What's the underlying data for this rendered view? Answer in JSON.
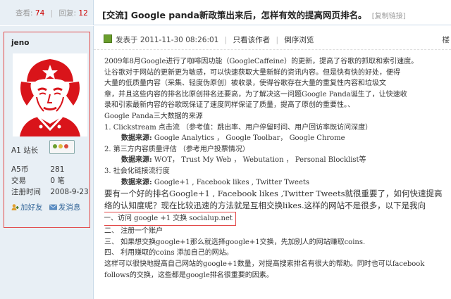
{
  "stats": {
    "views_label": "查看:",
    "views": "74",
    "replies_label": "回复:",
    "replies": "12"
  },
  "thread": {
    "title": "[交流] Google panda新政策出来后，怎样有效的提高网页排名。",
    "copy_link": "[复制链接]"
  },
  "user": {
    "name": "jeno",
    "level": "A1 站长",
    "info": [
      {
        "k": "A5币",
        "v": "281"
      },
      {
        "k": "交易",
        "v": "0 笔"
      },
      {
        "k": "注册时间",
        "v": "2008-9-23"
      }
    ],
    "add_friend": "加好友",
    "send_msg": "发消息"
  },
  "post": {
    "meta": "发表于 2011-11-30 08:26:01",
    "author_only": "只看该作者",
    "reverse": "倒序浏览",
    "floor": "楼"
  },
  "body": {
    "l1": "2009年8月Google进行了咖啡因功能（GoogleCaffeine）的更新，提高了谷歌的抓取和索引速度。",
    "l2": "让谷歌对于网站的更新更为敏感，可以快速获取大量新鲜的资讯内容。但是快有快的好处，便得",
    "l3": "大量的低质量内容（采集、轻度伪原创）被收录，使得谷歌存在大量的重复性内容和垃圾文",
    "l4": "章，并且这些内容的排名比原创排名还要高，为了解决这一问题Google Panda诞生了，让快速收",
    "l5": "录和引索最新内容的谷歌既保证了速度同样保证了质量，提高了原创的重要性。、",
    "l6": "Google Panda三大数据的来源",
    "l7": "1. Clickstream 点击流 （参考值：跳出率、用户停留时间、用户回访率既访问深度）",
    "l8_label": "数据来源:",
    "l8": " Google Analytics ， Google Toolbar， Google Chrome",
    "l9": "2. 第三方内容质量评估 （参考用户投票情况）",
    "l10_label": "数据来源:",
    "l10": " WOT， Trust My Web ， Webutation ， Personal Blocklist等",
    "l11": "3. 社会化链接流行度",
    "l12_label": "数据来源:",
    "l12": " Google+1 , Facebook likes , Twitter Tweets",
    "l13": "  要有一个好的排名Google+1 , Facebook likes ,Twitter Tweets就很重要了，如何快速提高",
    "l14": "络的认知度呢？现在比较迅速的方法就是互相交换likes.这样的网站不是很多，以下是我向",
    "l15": "一、访问 google +1 交换 socialup.net",
    "l16": "二、  注册一个账户",
    "l17": "三、  如果想交换google+1那么就选择google+1交换，先加别人的网站赚取coins.",
    "l18": "四、  利用赚取的coins 添加自己的网站。",
    "l19": "这样可以很快地提高自己网站的google+1数量，对提高搜索排名有很大的帮助。同时也可以facebook",
    "l20": "follows的交换，这些都是google排名很重要的因素。"
  },
  "colors": {
    "sidebar_bg": "#e8eff5",
    "highlight_border": "#e24a4a",
    "link": "#336699"
  }
}
